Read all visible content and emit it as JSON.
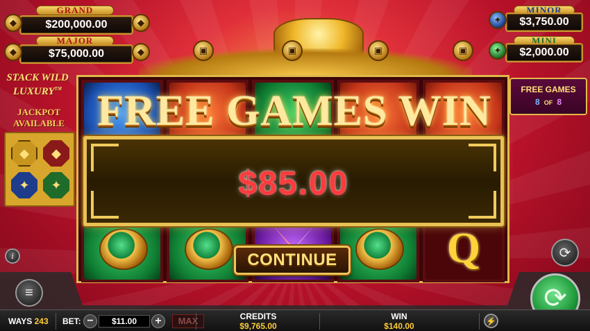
{
  "jackpots": {
    "grand": {
      "label": "GRAND",
      "value": "$200,000.00"
    },
    "major": {
      "label": "MAJOR",
      "value": "$75,000.00"
    },
    "minor": {
      "label": "MINOR",
      "value": "$3,750.00"
    },
    "mini": {
      "label": "MINI",
      "value": "$2,000.00"
    }
  },
  "logo": {
    "line1": "STACK WILD",
    "line2": "LUXURY",
    "tm": "TM"
  },
  "jackpot_available": {
    "line1": "JACKPOT",
    "line2": "AVAILABLE"
  },
  "free_games": {
    "label": "FREE GAMES",
    "current": "8",
    "of": "OF",
    "total": "8"
  },
  "popup": {
    "title": "FREE GAMES WIN",
    "amount": "$85.00",
    "continue_label": "CONTINUE"
  },
  "reel_symbols": {
    "bottom_right_letter": "Q"
  },
  "bottom_bar": {
    "ways_label": "WAYS",
    "ways_value": "243",
    "bet_label": "BET:",
    "bet_value": "$11.00",
    "minus": "−",
    "plus": "+",
    "max_label": "MAX",
    "credits_label": "CREDITS",
    "credits_value": "$9,765.00",
    "win_label": "WIN",
    "win_value": "$140.00"
  },
  "icons": {
    "info": "info-icon",
    "menu": "menu-icon",
    "autoplay": "autoplay-icon",
    "spin": "spin-icon",
    "turbo": "lightning-icon"
  },
  "colors": {
    "background": "#b8122a",
    "gold": "#e9c155",
    "win_amount": "#ff3b3b",
    "spin_button": "#1f9a3a"
  }
}
